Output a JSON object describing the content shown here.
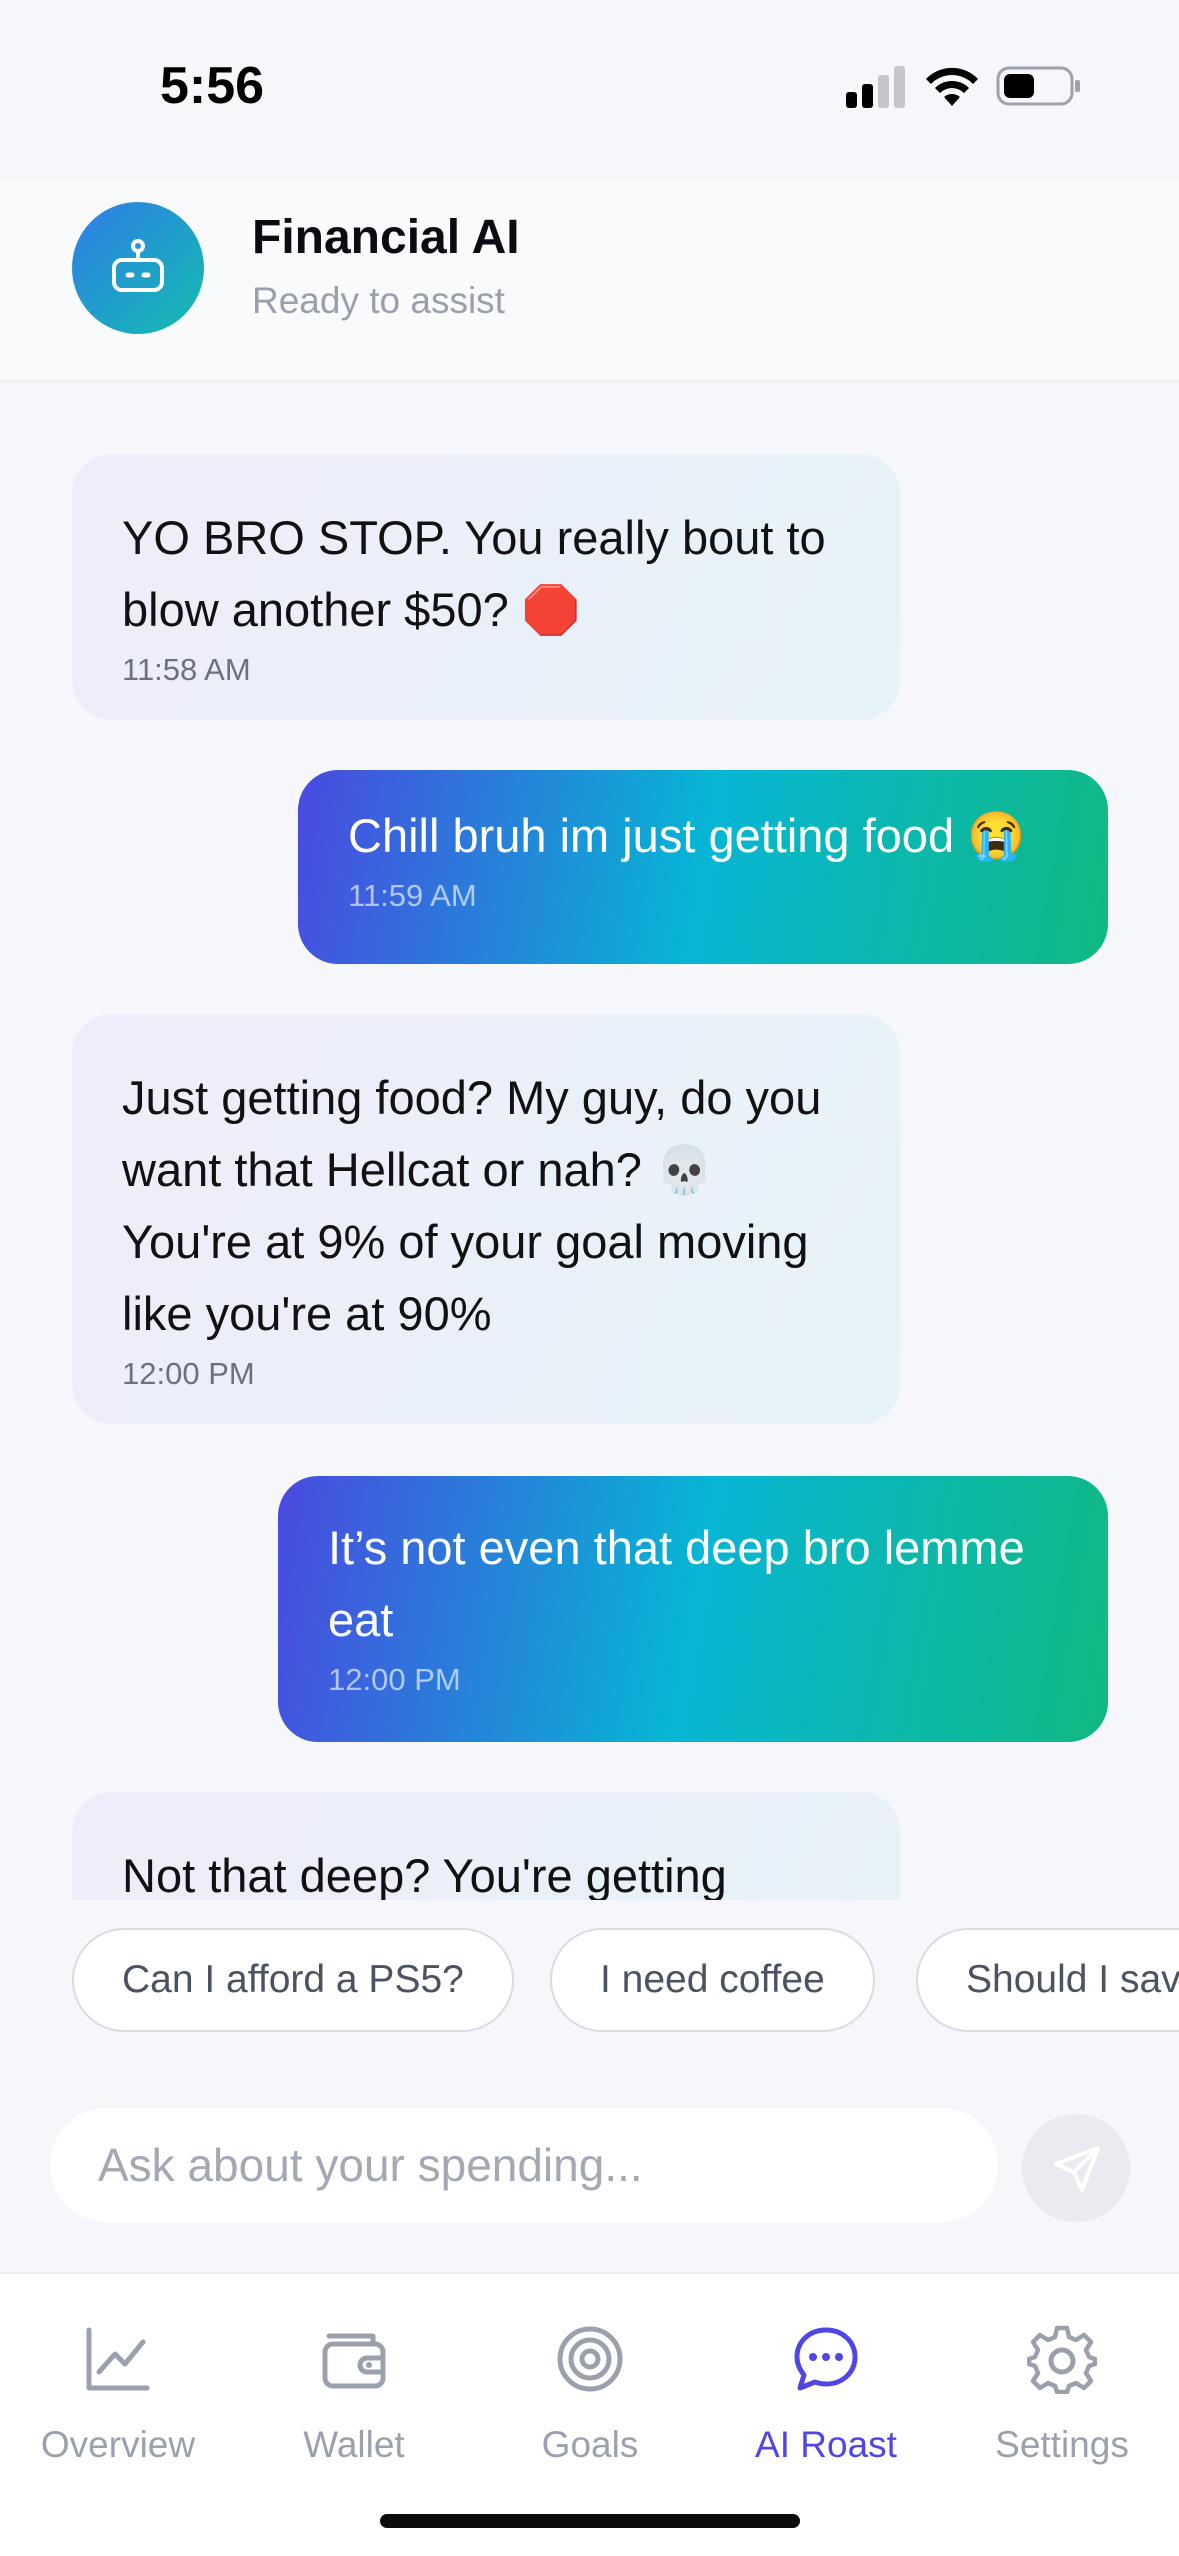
{
  "status_bar": {
    "time": "5:56"
  },
  "header": {
    "title": "Financial AI",
    "subtitle": "Ready to assist"
  },
  "messages": [
    {
      "sender": "ai",
      "text": "YO BRO STOP. You really bout to blow another $50? 🛑",
      "time": "11:58 AM"
    },
    {
      "sender": "user",
      "text": "Chill bruh im just getting food 😭",
      "time": "11:59 AM"
    },
    {
      "sender": "ai",
      "text": "Just getting food? My guy, do you want that Hellcat or nah? 💀 You're at 9% of your goal moving like you're at 90%",
      "time": "12:00 PM"
    },
    {
      "sender": "user",
      "text": "It’s not even that deep bro lemme eat",
      "time": "12:00 PM"
    },
    {
      "sender": "ai",
      "text": "Not that deep? You're getting",
      "time": ""
    }
  ],
  "suggestions": [
    "Can I afford a PS5?",
    "I need coffee",
    "Should I save"
  ],
  "input": {
    "placeholder": "Ask about your spending..."
  },
  "nav": {
    "items": [
      {
        "label": "Overview",
        "icon": "chart-line-icon"
      },
      {
        "label": "Wallet",
        "icon": "wallet-icon"
      },
      {
        "label": "Goals",
        "icon": "target-icon"
      },
      {
        "label": "AI Roast",
        "icon": "chat-bubble-icon",
        "active": true
      },
      {
        "label": "Settings",
        "icon": "gear-icon"
      }
    ]
  },
  "colors": {
    "accent": "#5046e5",
    "user_gradient": [
      "#4a49e0",
      "#06b6d4",
      "#10b981"
    ],
    "avatar_gradient": [
      "#2f7de8",
      "#13bdb0"
    ]
  }
}
